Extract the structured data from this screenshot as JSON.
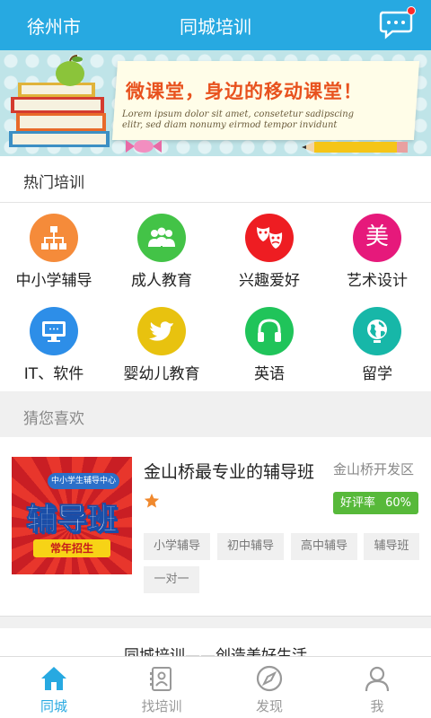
{
  "header": {
    "city": "徐州市",
    "title": "同城培训",
    "message_icon": "chat-bubble-icon",
    "badge_color": "#ff2a2a",
    "bar_color": "#27a9e1"
  },
  "banner": {
    "slogan": "微课堂，身边的移动课堂！",
    "lorem": "Lorem ipsum dolor sit amet, consetetur sadipscing elitr, sed diam nonumy eirmod tempor invidunt"
  },
  "hot": {
    "heading": "热门培训",
    "categories": [
      {
        "label": "中小学辅导",
        "icon": "hierarchy-icon",
        "color": "#f58b3a"
      },
      {
        "label": "成人教育",
        "icon": "group-icon",
        "color": "#43c347"
      },
      {
        "label": "兴趣爱好",
        "icon": "theater-masks-icon",
        "color": "#ee1d22"
      },
      {
        "label": "艺术设计",
        "icon": "mei-character-icon",
        "color": "#e6197b",
        "glyph": "美"
      },
      {
        "label": "IT、软件",
        "icon": "monitor-icon",
        "color": "#2d8ee8"
      },
      {
        "label": "婴幼儿教育",
        "icon": "bird-icon",
        "color": "#e8c20f"
      },
      {
        "label": "英语",
        "icon": "headphones-icon",
        "color": "#20c45a"
      },
      {
        "label": "留学",
        "icon": "globe-icon",
        "color": "#17b7a8"
      }
    ]
  },
  "guess": {
    "heading": "猜您喜欢"
  },
  "listing": {
    "name": "金山桥最专业的辅导班",
    "area": "金山桥开发区",
    "rating_label": "好评率",
    "rating_value": "60%",
    "stars": 1,
    "thumb": {
      "pill": "中小学生辅导中心",
      "big": "辅导班",
      "ribbon": "常年招生"
    },
    "tags": [
      "小学辅导",
      "初中辅导",
      "高中辅导",
      "辅导班",
      "一对一"
    ]
  },
  "footer_note": "同城培训——创造美好生活",
  "tabbar": {
    "tabs": [
      {
        "label": "同城",
        "icon": "home-icon",
        "active": true
      },
      {
        "label": "找培训",
        "icon": "search-training-icon",
        "active": false
      },
      {
        "label": "发现",
        "icon": "compass-icon",
        "active": false
      },
      {
        "label": "我",
        "icon": "person-icon",
        "active": false
      }
    ],
    "active_color": "#27a9e1",
    "inactive_color": "#999999"
  }
}
